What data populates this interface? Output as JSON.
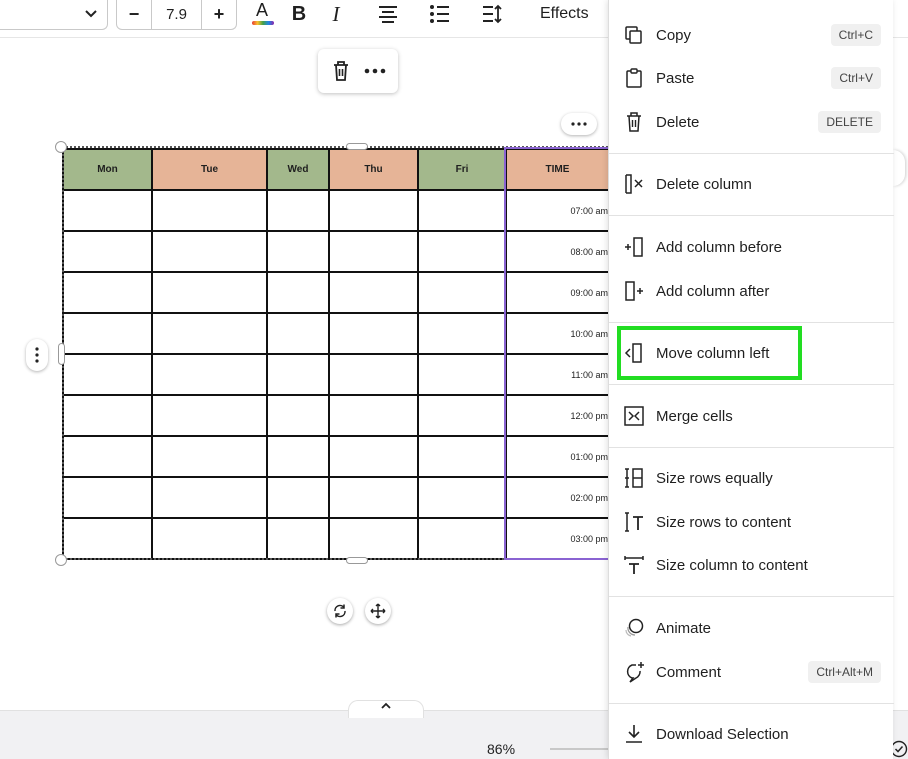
{
  "toolbar": {
    "font_size": "7.9",
    "decrease_label": "−",
    "increase_label": "+",
    "bold_label": "B",
    "italic_label": "I",
    "text_color_letter": "A",
    "effects_label": "Effects"
  },
  "table": {
    "headers": [
      {
        "label": "Mon",
        "color": "#a3b88c"
      },
      {
        "label": "Tue",
        "color": "#e6b497"
      },
      {
        "label": "Wed",
        "color": "#a3b88c"
      },
      {
        "label": "Thu",
        "color": "#e6b497"
      },
      {
        "label": "Fri",
        "color": "#a3b88c"
      },
      {
        "label": "TIME",
        "color": "#e6b497"
      }
    ],
    "times": [
      "07:00 am",
      "08:00 am",
      "09:00 am",
      "10:00 am",
      "11:00 am",
      "12:00 pm",
      "01:00 pm",
      "02:00 pm",
      "03:00 pm"
    ]
  },
  "bottom": {
    "zoom": "86%"
  },
  "menu": {
    "items": [
      {
        "label": "Copy",
        "shortcut": "Ctrl+C",
        "icon": "copy-icon"
      },
      {
        "label": "Paste",
        "shortcut": "Ctrl+V",
        "icon": "paste-icon"
      },
      {
        "label": "Delete",
        "shortcut": "DELETE",
        "icon": "trash-icon"
      },
      {
        "label": "Delete column",
        "shortcut": "",
        "icon": "delete-column-icon"
      },
      {
        "label": "Add column before",
        "shortcut": "",
        "icon": "add-column-before-icon"
      },
      {
        "label": "Add column after",
        "shortcut": "",
        "icon": "add-column-after-icon"
      },
      {
        "label": "Move column left",
        "shortcut": "",
        "icon": "move-column-left-icon"
      },
      {
        "label": "Merge cells",
        "shortcut": "",
        "icon": "merge-cells-icon"
      },
      {
        "label": "Size rows equally",
        "shortcut": "",
        "icon": "size-rows-equally-icon"
      },
      {
        "label": "Size rows to content",
        "shortcut": "",
        "icon": "size-rows-content-icon"
      },
      {
        "label": "Size column to content",
        "shortcut": "",
        "icon": "size-column-content-icon"
      },
      {
        "label": "Animate",
        "shortcut": "",
        "icon": "animate-icon"
      },
      {
        "label": "Comment",
        "shortcut": "Ctrl+Alt+M",
        "icon": "comment-icon"
      },
      {
        "label": "Download Selection",
        "shortcut": "",
        "icon": "download-icon"
      }
    ],
    "highlight_color": "#22dd22"
  }
}
